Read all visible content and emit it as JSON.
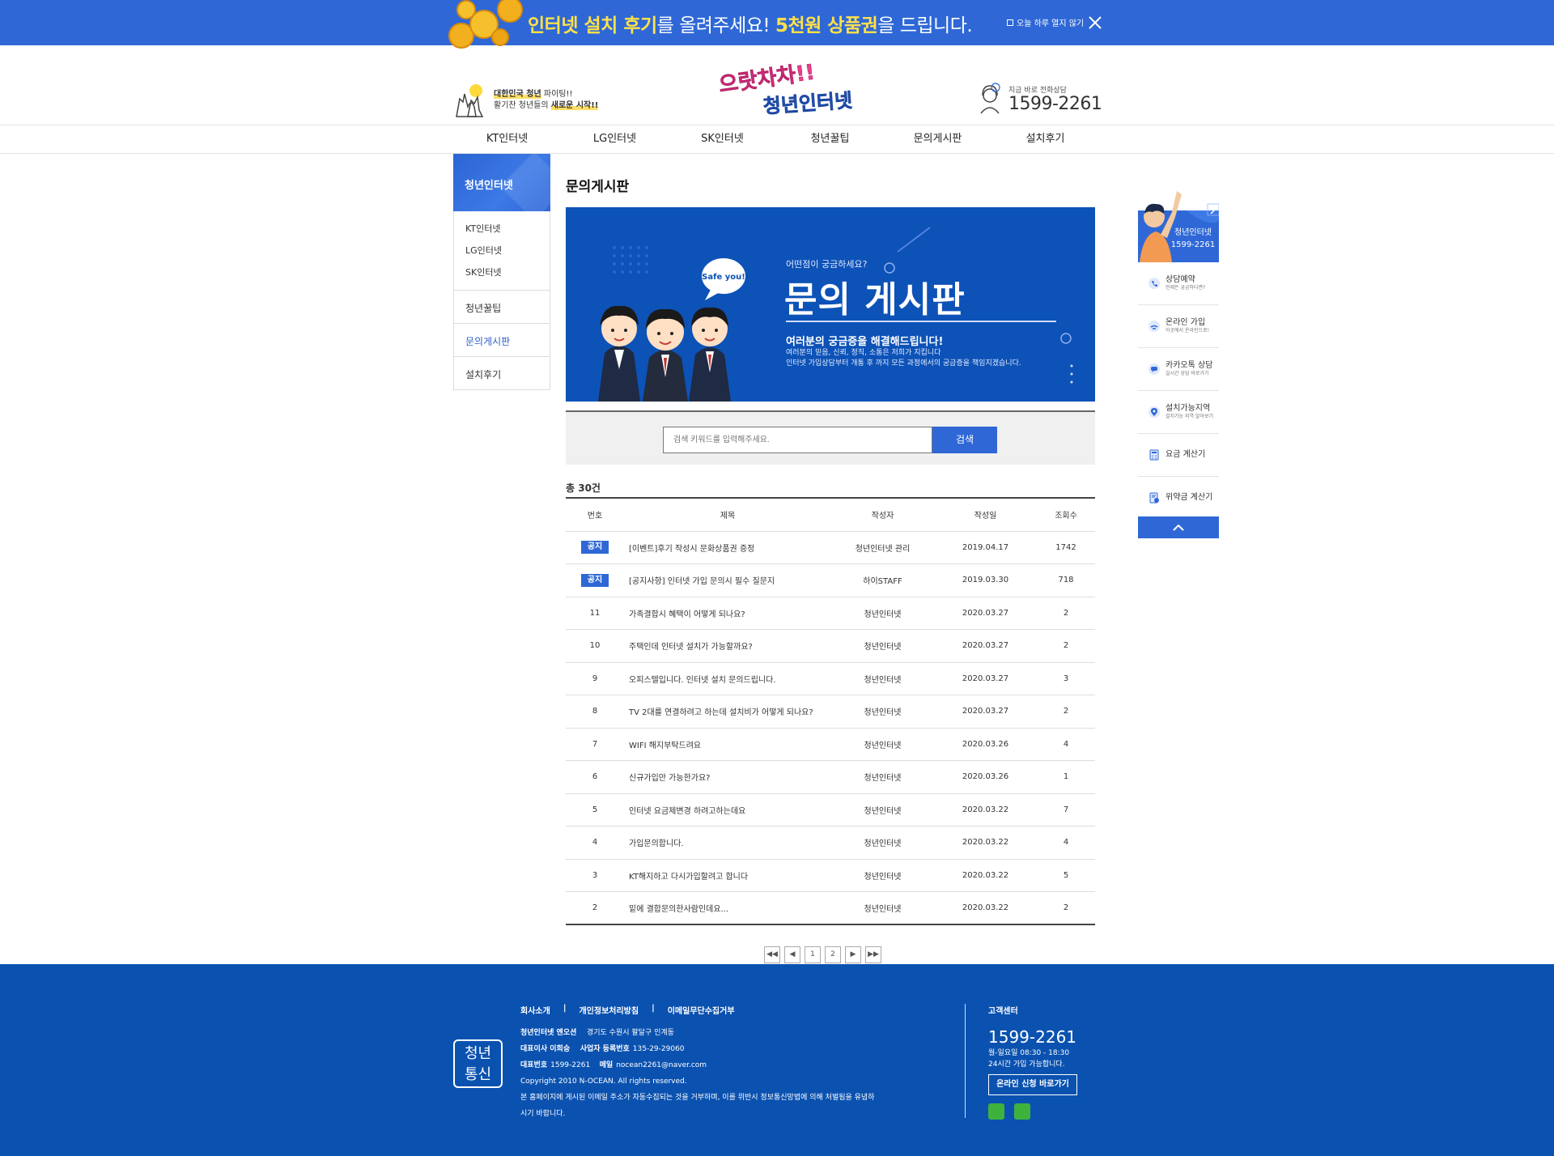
{
  "promo": {
    "part1": "인터넷 설치 후기",
    "part2": "를 올려주세요! ",
    "part3": "5천원 상품권",
    "part4": "을 드립니다.",
    "dont_show": "오늘 하루 열지 않기"
  },
  "header": {
    "slogan_line1_hl": "대한민국 청년",
    "slogan_line1_rest": " 파이팅!!",
    "slogan_line2_pre": "활기찬 청년들의 ",
    "slogan_line2_hl": "새로운 시작!!",
    "logo_line1": "으랏차차!!",
    "logo_line2": "청년인터넷",
    "phone_label": "지금 바로 전화상담",
    "phone_number": "1599-2261"
  },
  "gnb": [
    "KT인터넷",
    "LG인터넷",
    "SK인터넷",
    "청년꿀팁",
    "문의게시판",
    "설치후기"
  ],
  "lnb": {
    "title": "청년인터넷",
    "sub": [
      "KT인터넷",
      "LG인터넷",
      "SK인터넷"
    ],
    "items": [
      "청년꿀팁",
      "문의게시판",
      "설치후기"
    ]
  },
  "page": {
    "title": "문의게시판"
  },
  "banner": {
    "badge": "Safe you!",
    "question": "어떤점이 궁금하세요?",
    "title": "문의 게시판",
    "subtitle": "여러분의 궁금증을 해결해드립니다!",
    "desc1": "여러분의 믿음, 신뢰, 정직, 소통은 저희가 지킵니다",
    "desc2": "인터넷 가입상담부터 개통 후 까지 모든 과정에서의 궁금증을 책임지겠습니다."
  },
  "search": {
    "placeholder": "검색 키워드를 입력해주세요.",
    "button": "검색"
  },
  "board": {
    "total": "총 30건",
    "columns": [
      "번호",
      "제목",
      "작성자",
      "작성일",
      "조회수"
    ],
    "notice_label": "공지",
    "rows": [
      {
        "no": "공지",
        "title": "[이벤트]후기 작성시 문화상품권 증정",
        "author": "청년인터넷 관리",
        "date": "2019.04.17",
        "views": "1742"
      },
      {
        "no": "공지",
        "title": "[공지사항] 인터넷 가입 문의시 필수 질문지",
        "author": "하이STAFF",
        "date": "2019.03.30",
        "views": "718"
      },
      {
        "no": "11",
        "title": "가족결합시 혜택이 어떻게 되나요?",
        "author": "청년인터넷",
        "date": "2020.03.27",
        "views": "2"
      },
      {
        "no": "10",
        "title": "주택인데 인터넷 설치가 가능할까요?",
        "author": "청년인터넷",
        "date": "2020.03.27",
        "views": "2"
      },
      {
        "no": "9",
        "title": "오피스텔입니다. 인터넷 설치 문의드립니다.",
        "author": "청년인터넷",
        "date": "2020.03.27",
        "views": "3"
      },
      {
        "no": "8",
        "title": "TV 2대를 연결하려고 하는데 설치비가 어떻게 되나요?",
        "author": "청년인터넷",
        "date": "2020.03.27",
        "views": "2"
      },
      {
        "no": "7",
        "title": "WIFI 해지부탁드려요",
        "author": "청년인터넷",
        "date": "2020.03.26",
        "views": "4"
      },
      {
        "no": "6",
        "title": "신규가입만 가능한가요?",
        "author": "청년인터넷",
        "date": "2020.03.26",
        "views": "1"
      },
      {
        "no": "5",
        "title": "인터넷 요금제변경 하려고하는데요",
        "author": "청년인터넷",
        "date": "2020.03.22",
        "views": "7"
      },
      {
        "no": "4",
        "title": "가입문의합니다.",
        "author": "청년인터넷",
        "date": "2020.03.22",
        "views": "4"
      },
      {
        "no": "3",
        "title": "KT해지하고 다시가입할려고 합니다",
        "author": "청년인터넷",
        "date": "2020.03.22",
        "views": "5"
      },
      {
        "no": "2",
        "title": "밑에 결합문의한사람인데요...",
        "author": "청년인터넷",
        "date": "2020.03.22",
        "views": "2"
      }
    ]
  },
  "paging": {
    "first": "◀◀",
    "prev": "◀",
    "pages": [
      "1",
      "2"
    ],
    "next": "▶",
    "last": "▶▶"
  },
  "quick": {
    "title": "청년인터넷",
    "phone": "1599-2261",
    "items": [
      {
        "label": "상담예약",
        "sub": "언제든 궁금하다면?"
      },
      {
        "label": "온라인 가입",
        "sub": "이곳에서 온라인으로!"
      },
      {
        "label": "카카오톡 상담",
        "sub": "실시간 상담 바로가기"
      },
      {
        "label": "설치가능지역",
        "sub": "설치가능 지역 알아보기"
      },
      {
        "label": "요금 계산기",
        "sub": ""
      },
      {
        "label": "위약금 계산기",
        "sub": ""
      }
    ]
  },
  "footer": {
    "mark": [
      "청년",
      "통신"
    ],
    "links": [
      "회사소개",
      "|",
      "개인정보처리방침",
      "|",
      "이메일무단수집거부"
    ],
    "company_label": "청년인터넷 엔오션",
    "address": "경기도 수원시 팔달구 인계동",
    "ceo_label": "대표이사 이희승",
    "biz_label": "사업자 등록번호",
    "biz_no": "135-29-29060",
    "tel_label": "대표번호",
    "tel": "1599-2261",
    "mail_label": "메일",
    "mail": "nocean2261@naver.com",
    "copyright": "Copyright 2010 N-OCEAN. All rights reserved.",
    "notice1": "본 홈페이지에 게시된 이메일 주소가 자동수집되는 것을 거부하며, 이를 위반시 정보통신망법에 의해 처벌됨을 유념하",
    "notice2": "시기 바랍니다.",
    "cs_label": "고객센터",
    "cs_number": "1599-2261",
    "cs_hours1": "월-일요일 08:30 - 18:30",
    "cs_hours2": "24시간 가입 가능합니다.",
    "apply_button": "온라인 신청 바로가기"
  }
}
